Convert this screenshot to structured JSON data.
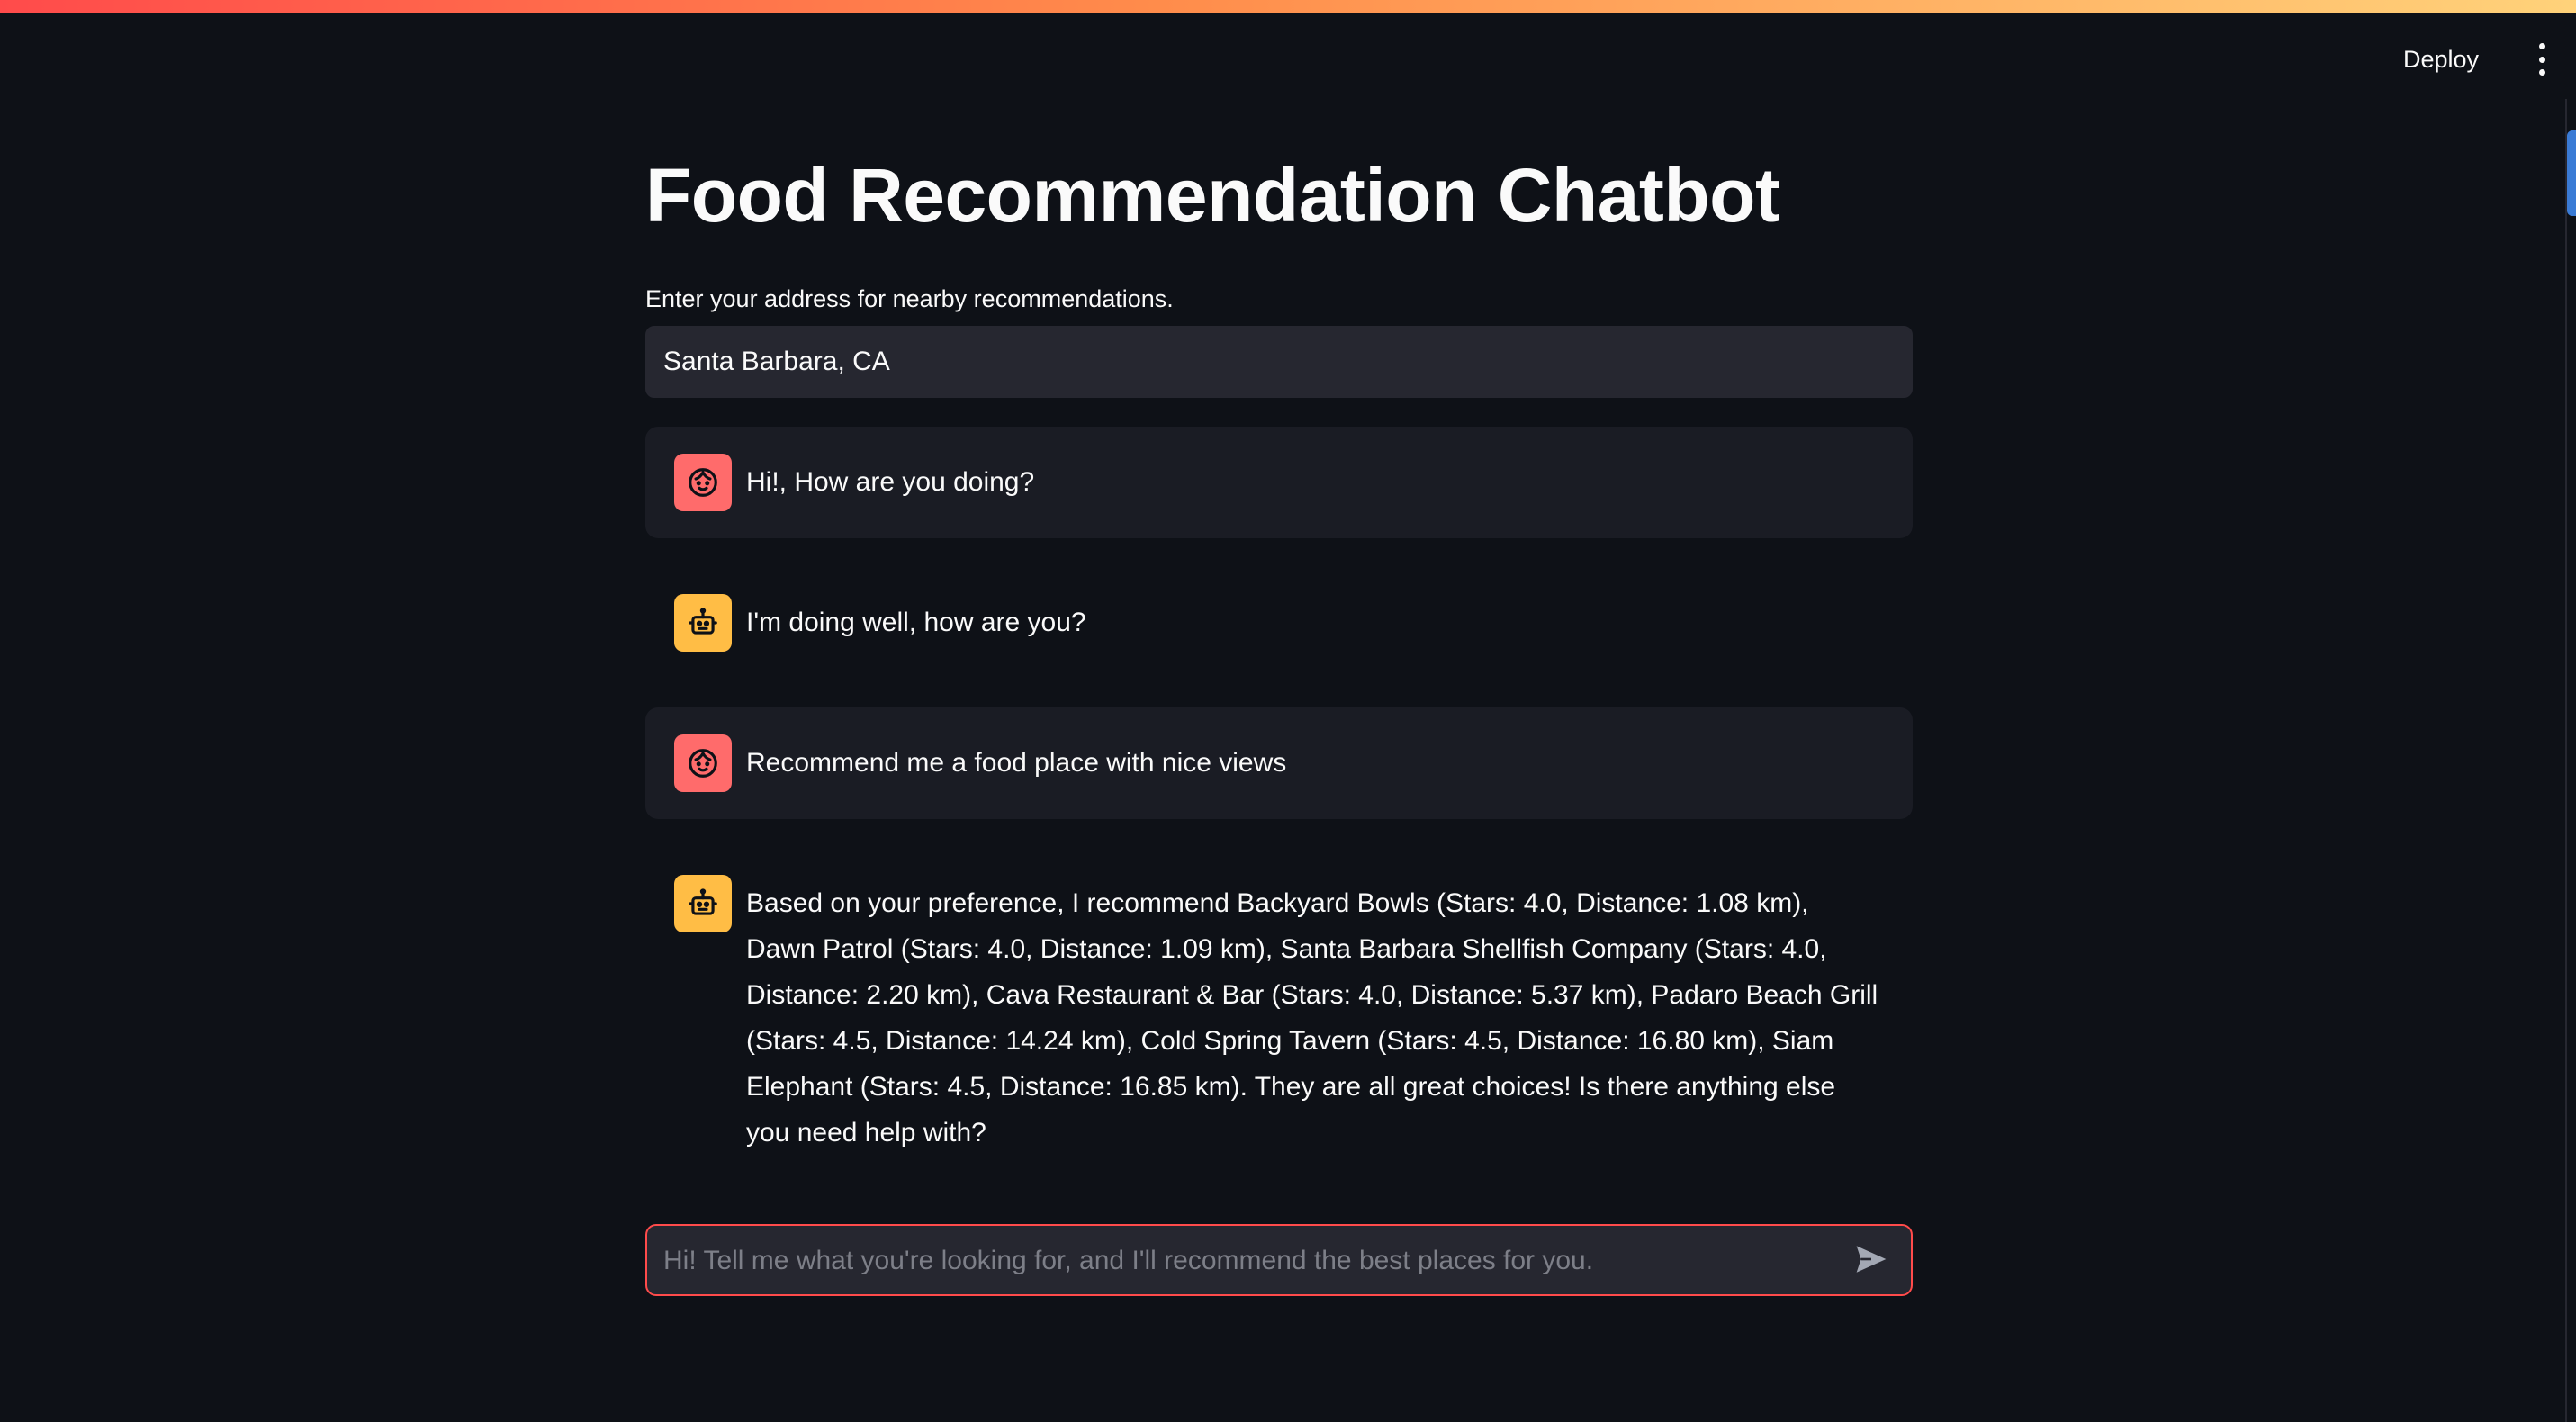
{
  "header": {
    "deploy_label": "Deploy",
    "menu_icon": "kebab-menu-icon"
  },
  "main": {
    "title": "Food Recommendation Chatbot",
    "address": {
      "label": "Enter your address for nearby recommendations.",
      "value": "Santa Barbara, CA"
    }
  },
  "chat": {
    "messages": [
      {
        "role": "user",
        "avatar_icon": "user-face-icon",
        "text": "Hi!, How are you doing?"
      },
      {
        "role": "assistant",
        "avatar_icon": "robot-icon",
        "text": "I'm doing well, how are you?"
      },
      {
        "role": "user",
        "avatar_icon": "user-face-icon",
        "text": "Recommend me a food place with nice views"
      },
      {
        "role": "assistant",
        "avatar_icon": "robot-icon",
        "text": "Based on your preference, I recommend Backyard Bowls (Stars: 4.0, Distance: 1.08 km), Dawn Patrol (Stars: 4.0, Distance: 1.09 km), Santa Barbara Shellfish Company (Stars: 4.0, Distance: 2.20 km), Cava Restaurant & Bar (Stars: 4.0, Distance: 5.37 km), Padaro Beach Grill (Stars: 4.5, Distance: 14.24 km), Cold Spring Tavern (Stars: 4.5, Distance: 16.80 km), Siam Elephant (Stars: 4.5, Distance: 16.85 km). They are all great choices! Is there anything else you need help with?"
      }
    ],
    "input": {
      "value": "",
      "placeholder": "Hi! Tell me what you're looking for, and I'll recommend the best places for you.",
      "send_icon": "send-icon"
    }
  },
  "colors": {
    "background": "#0e1117",
    "user_avatar": "#ff6b6b",
    "bot_avatar": "#ffbd45",
    "input_focus_border": "#ff4b4b",
    "scrollbar": "#3a7bd5"
  }
}
